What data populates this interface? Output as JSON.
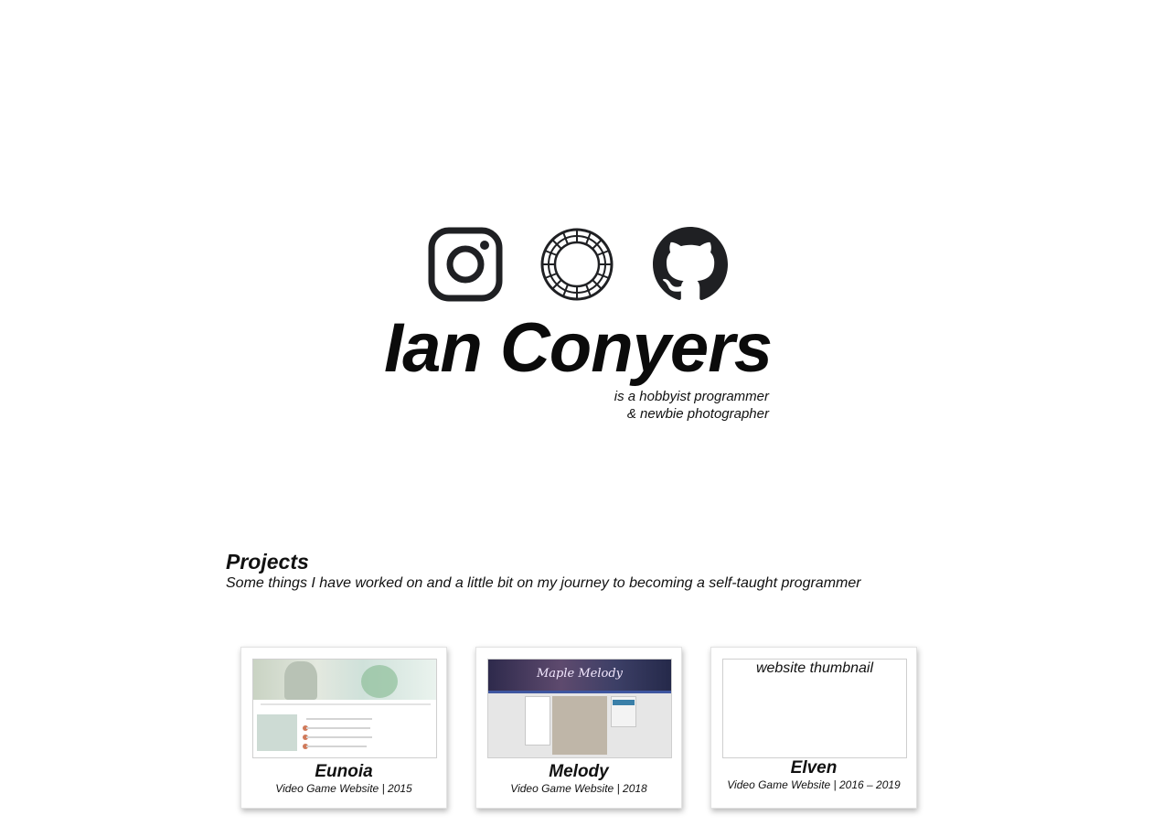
{
  "header": {
    "name": "Ian Conyers",
    "tagline_line1": "is a hobbyist programmer",
    "tagline_line2": "& newbie photographer"
  },
  "social": [
    {
      "icon": "instagram-icon",
      "label": "Instagram"
    },
    {
      "icon": "vsco-icon",
      "label": "VSCO"
    },
    {
      "icon": "github-icon",
      "label": "GitHub"
    }
  ],
  "projects": {
    "title": "Projects",
    "subtitle": "Some things I have worked on and a little bit on my journey to becoming a self-taught programmer",
    "items": [
      {
        "title": "Eunoia",
        "meta": "Video Game Website | 2015"
      },
      {
        "title": "Melody",
        "meta": "Video Game Website | 2018",
        "thumb_text": "Maple Melody"
      },
      {
        "title": "Elven",
        "meta": "Video Game Website | 2016 – 2019",
        "thumb_alt": "website thumbnail"
      }
    ]
  },
  "colors": {
    "text": "#111111",
    "icon": "#1f2023",
    "background": "#ffffff"
  }
}
